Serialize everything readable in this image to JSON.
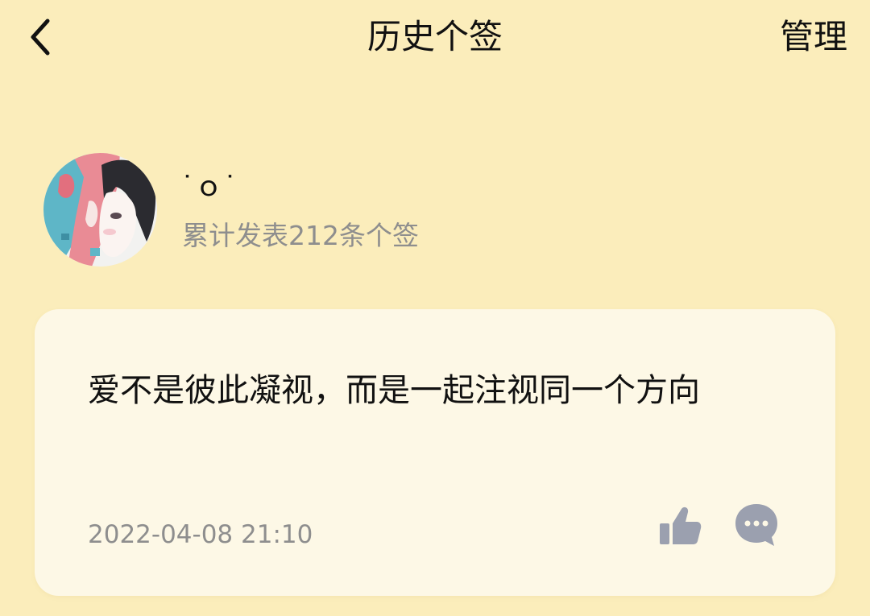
{
  "header": {
    "title": "历史个签",
    "manage_label": "管理",
    "back_icon": "chevron-left-icon"
  },
  "profile": {
    "nickname": "˙ｏ˙",
    "stats_text": "累计发表212条个签",
    "avatar": "illustrated-girl-avatar"
  },
  "signature": {
    "text": "爱不是彼此凝视，而是一起注视同一个方向",
    "timestamp": "2022-04-08 21:10",
    "like_icon": "thumbs-up-icon",
    "comment_icon": "comment-bubble-icon"
  },
  "colors": {
    "background": "#FBEDBB",
    "card": "#FDF8E6",
    "secondary_text": "#8E8E8E",
    "icon_gray": "#9BA0AF"
  }
}
